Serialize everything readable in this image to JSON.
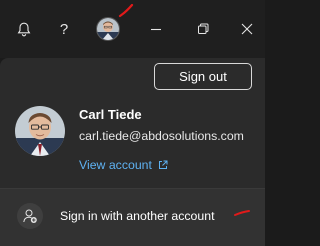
{
  "titlebar": {
    "icons": [
      "bell-icon",
      "help-icon",
      "avatar",
      "minimize-icon",
      "restore-icon",
      "close-icon"
    ],
    "help_glyph": "?"
  },
  "account_panel": {
    "sign_out_label": "Sign out",
    "user": {
      "name": "Carl Tiede",
      "email": "carl.tiede@abdosolutions.com"
    },
    "view_account_label": "View account",
    "another_account_label": "Sign in with another account"
  },
  "colors": {
    "link": "#5fb2f2",
    "annotation": "#e11a1a"
  }
}
